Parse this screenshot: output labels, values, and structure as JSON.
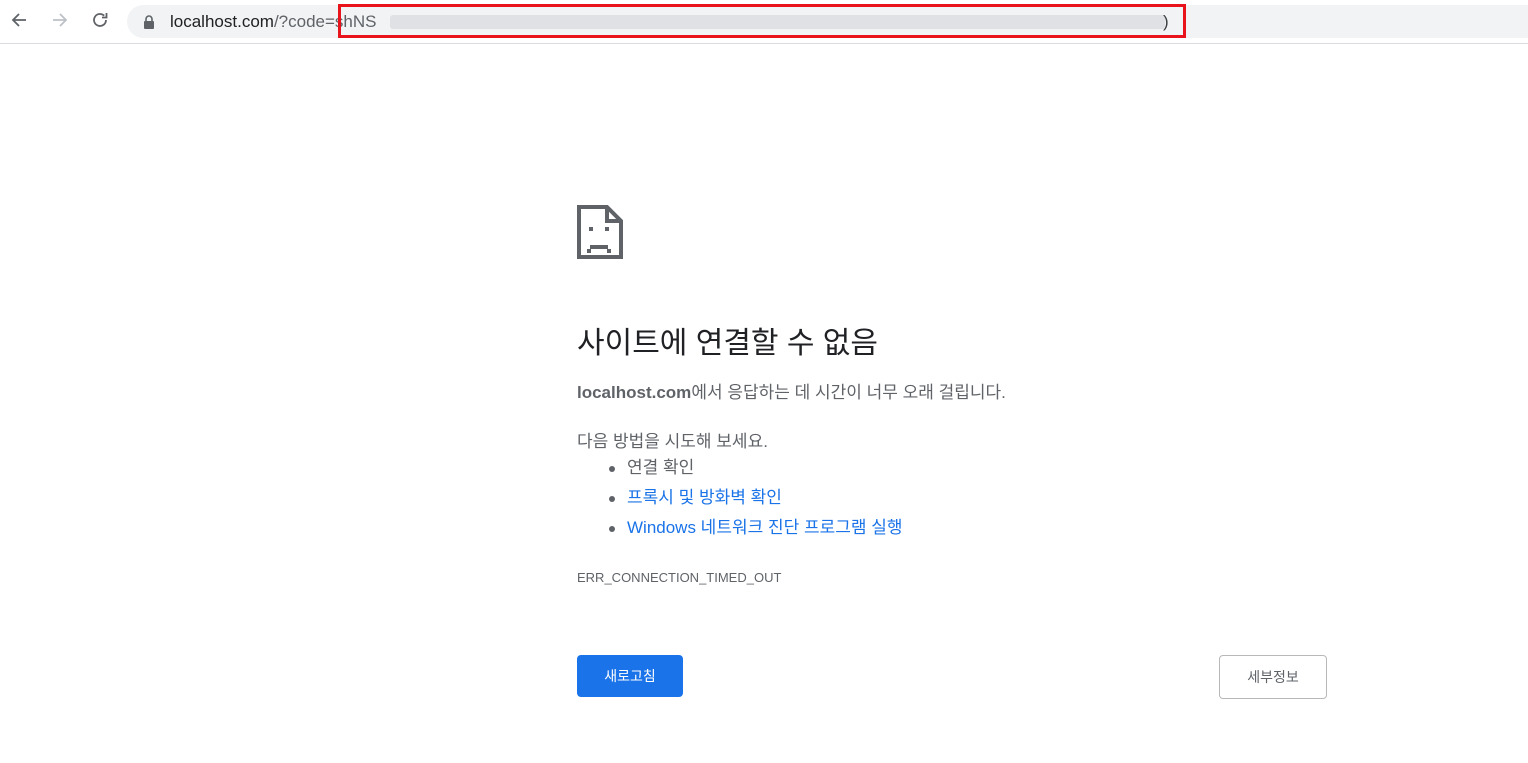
{
  "toolbar": {
    "back_icon": "arrow-left-icon",
    "forward_icon": "arrow-right-icon",
    "reload_icon": "refresh-icon",
    "lock_icon": "lock-icon",
    "url_host": "localhost.com",
    "url_path": "/?code=shNS",
    "url_tail": ")"
  },
  "error": {
    "icon": "sad-document-icon",
    "title": "사이트에 연결할 수 없음",
    "desc_host": "localhost.com",
    "desc_rest": "에서 응답하는 데 시간이 너무 오래 걸립니다.",
    "suggest_heading": "다음 방법을 시도해 보세요.",
    "suggestions": [
      {
        "label": "연결 확인",
        "link": false
      },
      {
        "label": "프록시 및 방화벽 확인",
        "link": true
      },
      {
        "label": "Windows 네트워크 진단 프로그램 실행",
        "link": true
      }
    ],
    "code": "ERR_CONNECTION_TIMED_OUT"
  },
  "buttons": {
    "reload": "새로고침",
    "details": "세부정보"
  },
  "colors": {
    "primary": "#1a73e8",
    "highlight": "#e8131b",
    "text_secondary": "#5f6368"
  }
}
